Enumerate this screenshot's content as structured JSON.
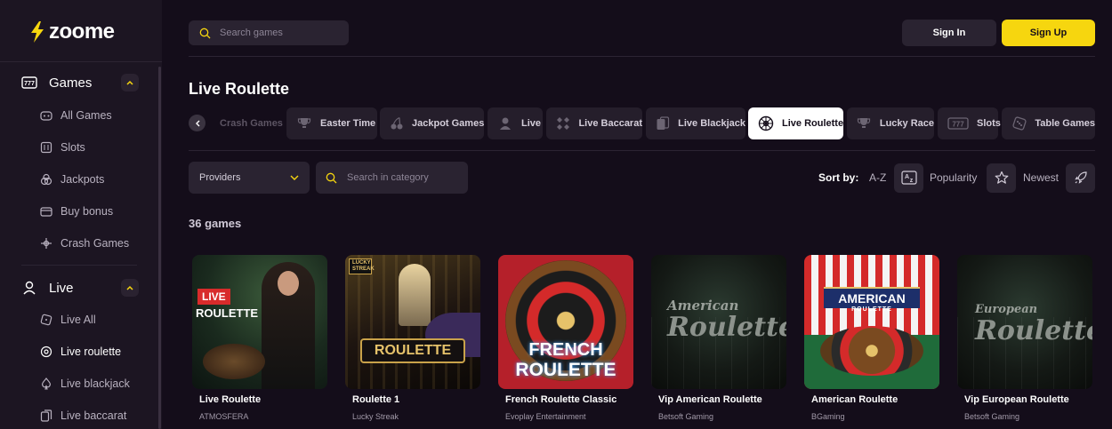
{
  "brand": {
    "name": "zoome",
    "accent": "#f6d60f"
  },
  "sidebar": {
    "games_section": {
      "label": "Games",
      "icon": "slots-icon"
    },
    "games_items": [
      {
        "label": "All Games",
        "icon": "gamepad-icon"
      },
      {
        "label": "Slots",
        "icon": "slot-machine-icon"
      },
      {
        "label": "Jackpots",
        "icon": "coins-icon"
      },
      {
        "label": "Buy bonus",
        "icon": "wallet-icon"
      },
      {
        "label": "Crash Games",
        "icon": "rocket-icon"
      }
    ],
    "live_section": {
      "label": "Live",
      "icon": "dealer-icon"
    },
    "live_items": [
      {
        "label": "Live All",
        "icon": "dice-icon"
      },
      {
        "label": "Live roulette",
        "icon": "roulette-icon"
      },
      {
        "label": "Live blackjack",
        "icon": "spade-icon"
      },
      {
        "label": "Live baccarat",
        "icon": "cards-icon"
      }
    ]
  },
  "header": {
    "search_placeholder": "Search games",
    "sign_in": "Sign In",
    "sign_up": "Sign Up"
  },
  "page": {
    "title": "Live Roulette"
  },
  "tabs": [
    {
      "label": "Crash Games",
      "faded": true
    },
    {
      "label": "Easter Time",
      "icon": "trophy-icon"
    },
    {
      "label": "Jackpot Games",
      "icon": "cherries-icon"
    },
    {
      "label": "Live",
      "icon": "dealer-icon"
    },
    {
      "label": "Live Baccarat",
      "icon": "diamonds-icon"
    },
    {
      "label": "Live Blackjack",
      "icon": "cards-icon"
    },
    {
      "label": "Live Roulette",
      "icon": "roulette-icon",
      "active": true
    },
    {
      "label": "Lucky Race",
      "icon": "trophy-icon"
    },
    {
      "label": "Slots",
      "icon": "777-icon"
    },
    {
      "label": "Table Games",
      "icon": "dice-icon"
    }
  ],
  "filters": {
    "providers_label": "Providers",
    "category_search_placeholder": "Search in category",
    "sort_by": "Sort by:",
    "sort_az": "A-Z",
    "sort_popularity": "Popularity",
    "sort_newest": "Newest"
  },
  "games_count": "36 games",
  "games": [
    {
      "title": "Live Roulette",
      "provider": "ATMOSFERA",
      "thumb_top": "LIVE",
      "thumb_main": "ROULETTE"
    },
    {
      "title": "Roulette 1",
      "provider": "Lucky Streak",
      "thumb_badge": "LUCKY STREAK",
      "thumb_main": "ROULETTE"
    },
    {
      "title": "French Roulette Classic",
      "provider": "Evoplay Entertainment",
      "thumb_top": "FRENCH",
      "thumb_main": "ROULETTE"
    },
    {
      "title": "Vip American Roulette",
      "provider": "Betsoft Gaming",
      "thumb_top": "American",
      "thumb_main": "Roulette"
    },
    {
      "title": "American Roulette",
      "provider": "BGaming",
      "thumb_top": "AMERICAN",
      "thumb_main": "ROULETTE"
    },
    {
      "title": "Vip European Roulette",
      "provider": "Betsoft Gaming",
      "thumb_top": "European",
      "thumb_main": "Roulette"
    }
  ]
}
